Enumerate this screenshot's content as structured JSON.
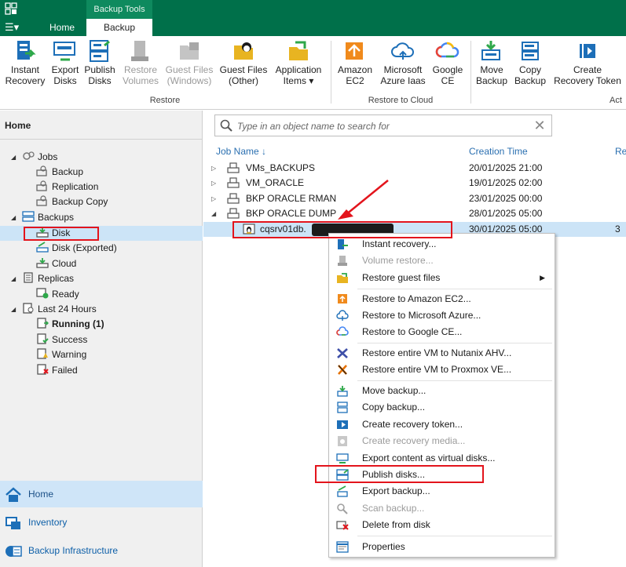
{
  "titlebar": {
    "context_tab_header": "Backup Tools",
    "tabs": [
      {
        "label": "Home"
      },
      {
        "label": "Backup"
      }
    ]
  },
  "ribbon": {
    "restore_group": {
      "label": "Restore",
      "buttons": [
        {
          "label1": "Instant",
          "label2": "Recovery"
        },
        {
          "label1": "Export",
          "label2": "Disks"
        },
        {
          "label1": "Publish",
          "label2": "Disks"
        },
        {
          "label1": "Restore",
          "label2": "Volumes"
        },
        {
          "label1": "Guest Files",
          "label2": "(Windows)"
        },
        {
          "label1": "Guest Files",
          "label2": "(Other)"
        },
        {
          "label1": "Application",
          "label2": "Items ▾"
        }
      ]
    },
    "cloud_group": {
      "label": "Restore to Cloud",
      "buttons": [
        {
          "label1": "Amazon",
          "label2": "EC2"
        },
        {
          "label1": "Microsoft",
          "label2": "Azure Iaas"
        },
        {
          "label1": "Google",
          "label2": "CE"
        }
      ]
    },
    "actions_group": {
      "label": "Act",
      "buttons": [
        {
          "label1": "Move",
          "label2": "Backup"
        },
        {
          "label1": "Copy",
          "label2": "Backup"
        },
        {
          "label1": "Create",
          "label2": "Recovery Token"
        }
      ]
    }
  },
  "nav": {
    "title": "Home",
    "tree": {
      "jobs": "Jobs",
      "backup": "Backup",
      "replication": "Replication",
      "backup_copy": "Backup Copy",
      "backups": "Backups",
      "disk": "Disk",
      "disk_exported": "Disk (Exported)",
      "cloud": "Cloud",
      "replicas": "Replicas",
      "ready": "Ready",
      "last24": "Last 24 Hours",
      "running": "Running (1)",
      "success": "Success",
      "warning": "Warning",
      "failed": "Failed"
    },
    "bottom": [
      {
        "label": "Home"
      },
      {
        "label": "Inventory"
      },
      {
        "label": "Backup Infrastructure"
      }
    ]
  },
  "search": {
    "placeholder": "Type in an object name to search for",
    "value": ""
  },
  "table": {
    "columns": [
      {
        "label": "Job Name ↓"
      },
      {
        "label": "Creation Time"
      },
      {
        "label": "Re"
      }
    ],
    "rows": [
      {
        "name": "VMs_BACKUPS",
        "time": "20/01/2025 21:00",
        "extra": ""
      },
      {
        "name": "VM_ORACLE",
        "time": "19/01/2025 02:00",
        "extra": ""
      },
      {
        "name": "BKP ORACLE RMAN",
        "time": "23/01/2025 00:00",
        "extra": ""
      },
      {
        "name": "BKP ORACLE DUMP",
        "time": "28/01/2025 05:00",
        "extra": ""
      },
      {
        "name": "cqsrv01db.",
        "time": "30/01/2025 05:00",
        "extra": "3"
      }
    ]
  },
  "context_menu": {
    "items": [
      {
        "label": "Instant recovery...",
        "enabled": true
      },
      {
        "label": "Volume restore...",
        "enabled": false
      },
      {
        "label": "Restore guest files",
        "enabled": true
      },
      {
        "label": "Restore to Amazon EC2...",
        "enabled": true
      },
      {
        "label": "Restore to Microsoft Azure...",
        "enabled": true
      },
      {
        "label": "Restore to Google CE...",
        "enabled": true
      },
      {
        "label": "Restore entire VM to Nutanix AHV...",
        "enabled": true
      },
      {
        "label": "Restore entire VM to Proxmox VE...",
        "enabled": true
      },
      {
        "label": "Move backup...",
        "enabled": true
      },
      {
        "label": "Copy backup...",
        "enabled": true
      },
      {
        "label": "Create recovery token...",
        "enabled": true
      },
      {
        "label": "Create recovery media...",
        "enabled": false
      },
      {
        "label": "Export content as virtual disks...",
        "enabled": true
      },
      {
        "label": "Publish disks...",
        "enabled": true
      },
      {
        "label": "Export backup...",
        "enabled": true
      },
      {
        "label": "Scan backup...",
        "enabled": false
      },
      {
        "label": "Delete from disk",
        "enabled": true
      },
      {
        "label": "Properties",
        "enabled": true
      }
    ]
  },
  "colors": {
    "brand_green": "#00704a",
    "selection_blue": "#cce4f7",
    "annotation_red": "#e3141c",
    "link_blue": "#2a6fb0"
  }
}
